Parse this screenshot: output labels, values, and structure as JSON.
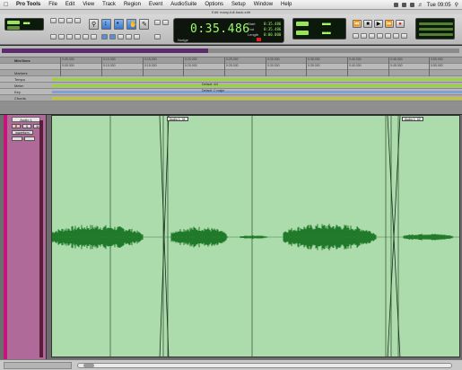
{
  "menubar": {
    "apple": "",
    "items": [
      "Pro Tools",
      "File",
      "Edit",
      "View",
      "Track",
      "Region",
      "Event",
      "AudioSuite",
      "Options",
      "Setup",
      "Window",
      "Help"
    ],
    "clock": "Tue 09:05"
  },
  "window": {
    "title": "Edit: many-full-track.edit"
  },
  "counter": {
    "main": "0:35.486",
    "start_label": "Start",
    "end_label": "End",
    "length_label": "Length",
    "start_value": "0:35.486",
    "end_value": "0:35.486",
    "length_value": "0:00.000",
    "nudge_label": "Nudge"
  },
  "rulers": {
    "min_secs_label": "Min:Secs",
    "rows": [
      "Markers",
      "Tempo",
      "Meter",
      "Key",
      "Chords"
    ],
    "meter_default": "Default: 4/4",
    "key_default": "Default: C major",
    "ticks": [
      "0:05.000",
      "0:10.000",
      "0:15.000",
      "0:20.000",
      "0:25.000",
      "0:30.000",
      "0:35.000",
      "0:40.000",
      "0:45.000",
      "0:50.000"
    ]
  },
  "track": {
    "name": "Audio 1",
    "buttons": [
      "R",
      "S",
      "M"
    ],
    "view": "waveform"
  },
  "clips": [
    {
      "label": "Audio 1_01"
    },
    {
      "label": "Audio 1_02"
    }
  ],
  "colors": {
    "clip_bg": "#acdcac",
    "waveform": "#1f7a2a",
    "track_color": "#c7147a",
    "lcd_text": "#9cff6b"
  }
}
